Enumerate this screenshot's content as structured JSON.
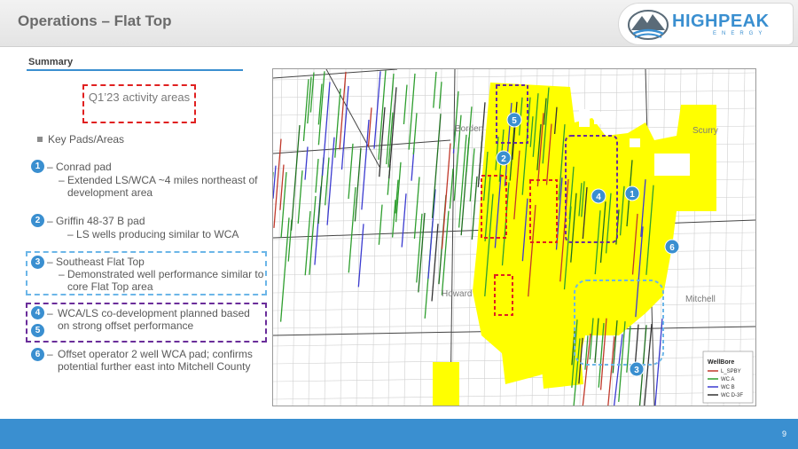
{
  "header": {
    "title": "Operations – Flat Top"
  },
  "logo": {
    "name": "HIGHPEAK",
    "sub": "ENERGY"
  },
  "summary": {
    "heading": "Summary",
    "activity_label": "Q1’23 activity areas"
  },
  "key_pads_label": "Key Pads/Areas",
  "items": [
    {
      "num": "1",
      "title": "Conrad pad",
      "detail": "Extended LS/WCA ~4 miles northeast of development area"
    },
    {
      "num": "2",
      "title": "Griffin 48-37 B pad",
      "detail": "LS wells producing similar to WCA"
    },
    {
      "num": "3",
      "title": "Southeast Flat Top",
      "detail": "Demonstrated well performance similar to core Flat Top area"
    },
    {
      "num": "4",
      "num2": "5",
      "title": "WCA/LS co-development planned based on strong offset performance"
    },
    {
      "num": "6",
      "title": "Offset operator 2 well WCA pad; confirms potential further east into Mitchell County"
    }
  ],
  "map": {
    "labels": {
      "borden": "Borden",
      "scurry": "Scurry",
      "howard": "Howard",
      "mitchell": "Mitchell"
    },
    "markers": [
      "5",
      "2",
      "4",
      "1",
      "6",
      "3"
    ],
    "legend": {
      "title": "WellBore",
      "entries": [
        {
          "label": "L_SPBY",
          "color": "#c0392b"
        },
        {
          "label": "WC A",
          "color": "#2e9e2e"
        },
        {
          "label": "WC B",
          "color": "#3b3bd0"
        },
        {
          "label": "WC D-3F",
          "color": "#333333"
        }
      ]
    }
  },
  "footer": {
    "page": "9"
  }
}
